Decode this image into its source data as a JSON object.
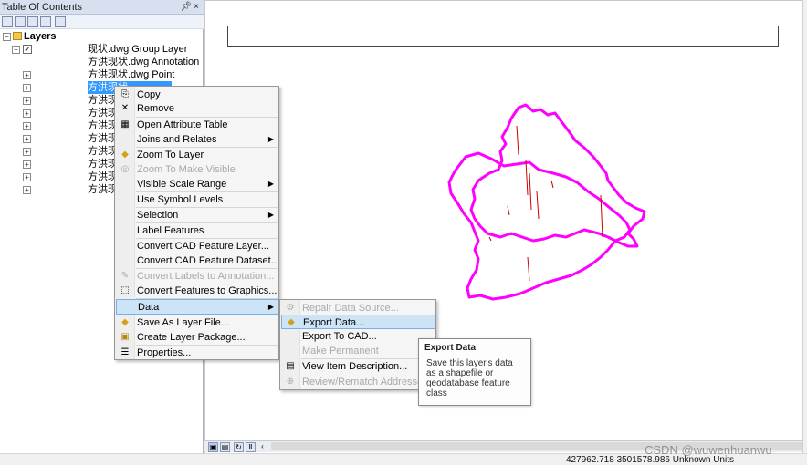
{
  "toc": {
    "title": "Table Of Contents",
    "pin_close": "p ×",
    "root_label": "Layers",
    "rows": [
      {
        "label": "现状.dwg Group Layer"
      },
      {
        "label": "方洪现状.dwg Annotation"
      },
      {
        "label": "方洪现状.dwg Point"
      },
      {
        "label": "方洪现状"
      },
      {
        "label": "方洪现状"
      },
      {
        "label": "方洪现状"
      },
      {
        "label": "方洪现状"
      },
      {
        "label": "方洪现状"
      },
      {
        "label": "方洪现状"
      },
      {
        "label": "方洪现状"
      },
      {
        "label": "方洪现状"
      },
      {
        "label": "方洪现状"
      }
    ]
  },
  "context_menu": {
    "items": [
      {
        "label": "Copy"
      },
      {
        "label": "Remove"
      },
      {
        "label": "Open Attribute Table"
      },
      {
        "label": "Joins and Relates"
      },
      {
        "label": "Zoom To Layer"
      },
      {
        "label": "Zoom To Make Visible"
      },
      {
        "label": "Visible Scale Range"
      },
      {
        "label": "Use Symbol Levels"
      },
      {
        "label": "Selection"
      },
      {
        "label": "Label Features"
      },
      {
        "label": "Convert CAD Feature Layer..."
      },
      {
        "label": "Convert CAD Feature Dataset..."
      },
      {
        "label": "Convert Labels to Annotation..."
      },
      {
        "label": "Convert Features to Graphics..."
      },
      {
        "label": "Data"
      },
      {
        "label": "Save As Layer File..."
      },
      {
        "label": "Create Layer Package..."
      },
      {
        "label": "Properties..."
      }
    ]
  },
  "data_submenu": {
    "items": [
      {
        "label": "Repair Data Source..."
      },
      {
        "label": "Export Data..."
      },
      {
        "label": "Export To CAD..."
      },
      {
        "label": "Make Permanent"
      },
      {
        "label": "View Item Description..."
      },
      {
        "label": "Review/Rematch Addresses..."
      }
    ]
  },
  "tooltip": {
    "title": "Export Data",
    "body": "Save this layer's data as a shapefile or geodatabase feature class"
  },
  "status": {
    "coordinates": "427962.718  3501578.986 Unknown Units"
  },
  "watermark": "CSDN @wuwenhuanwu",
  "colors": {
    "boundary": "#ff00ff",
    "features": "#cc0000",
    "selection": "#3399ff"
  }
}
